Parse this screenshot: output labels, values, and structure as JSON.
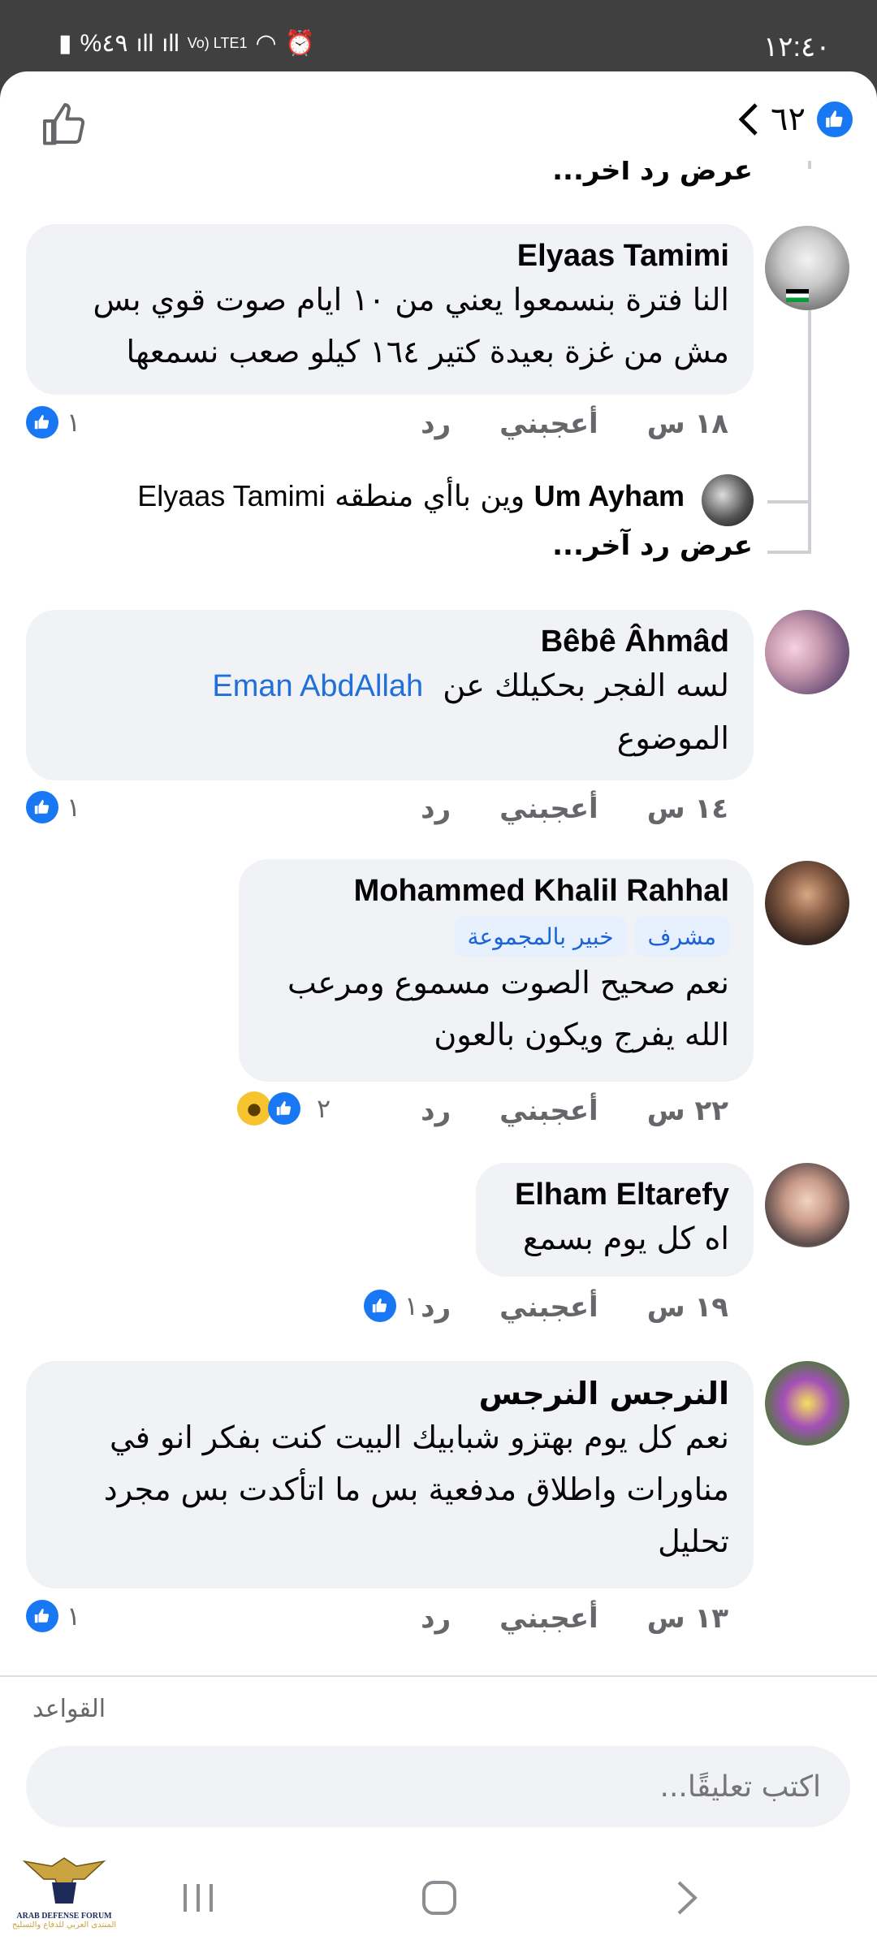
{
  "status": {
    "time": "١٢:٤٠",
    "battery": "%٤٩",
    "network": "Vo) LTE1"
  },
  "header": {
    "reaction_count": "٦٢"
  },
  "thread": {
    "top_more": "عرض رد آخر...",
    "comments": [
      {
        "author": "Elyaas Tamimi",
        "lines": [
          "النا فترة  بنسمعوا يعني من  ١٠ ايام صوت قوي بس",
          "مش من غزة بعيدة كتير ١٦٤ كيلو صعب نسمعها"
        ],
        "time": "١٨ س",
        "like": "أعجبني",
        "reply": "رد",
        "reactions": "١"
      },
      {
        "author": "Um Ayham",
        "text": "وين باأي منطقه",
        "mention": "Elyaas Tamimi",
        "more": "عرض رد آخر..."
      },
      {
        "author": "Bêbê Âhmâd",
        "text": "لسه الفجر بحكيلك عن",
        "mention": "Eman AbdAllah",
        "text2": "الموضوع",
        "time": "١٤ س",
        "like": "أعجبني",
        "reply": "رد",
        "reactions": "١"
      },
      {
        "author": "Mohammed Khalil Rahhal",
        "badge1": "مشرف",
        "badge2": "خبير بالمجموعة",
        "lines": [
          "نعم صحيح الصوت مسموع ومرعب",
          "الله يفرج ويكون بالعون"
        ],
        "time": "٢٢ س",
        "like": "أعجبني",
        "reply": "رد",
        "reactions": "٢"
      },
      {
        "author": "Elham Eltarefy",
        "lines": [
          "اه كل يوم بسمع"
        ],
        "time": "١٩ س",
        "like": "أعجبني",
        "reply": "رد",
        "reactions": "١"
      },
      {
        "author": "النرجس النرجس",
        "lines": [
          "نعم كل يوم بهتزو شبابيك البيت كنت بفكر انو في",
          "مناورات  واطلاق مدفعية بس ما اتأكدت بس مجرد",
          "تحليل"
        ],
        "time": "١٣ س",
        "like": "أعجبني",
        "reply": "رد",
        "reactions": "١"
      }
    ]
  },
  "footer": {
    "rules": "القواعد",
    "input_placeholder": "اكتب تعليقًا..."
  },
  "watermark": {
    "line1": "ARAB DEFENSE FORUM",
    "line2": "المنتدى العربي للدفاع والتسليح"
  }
}
